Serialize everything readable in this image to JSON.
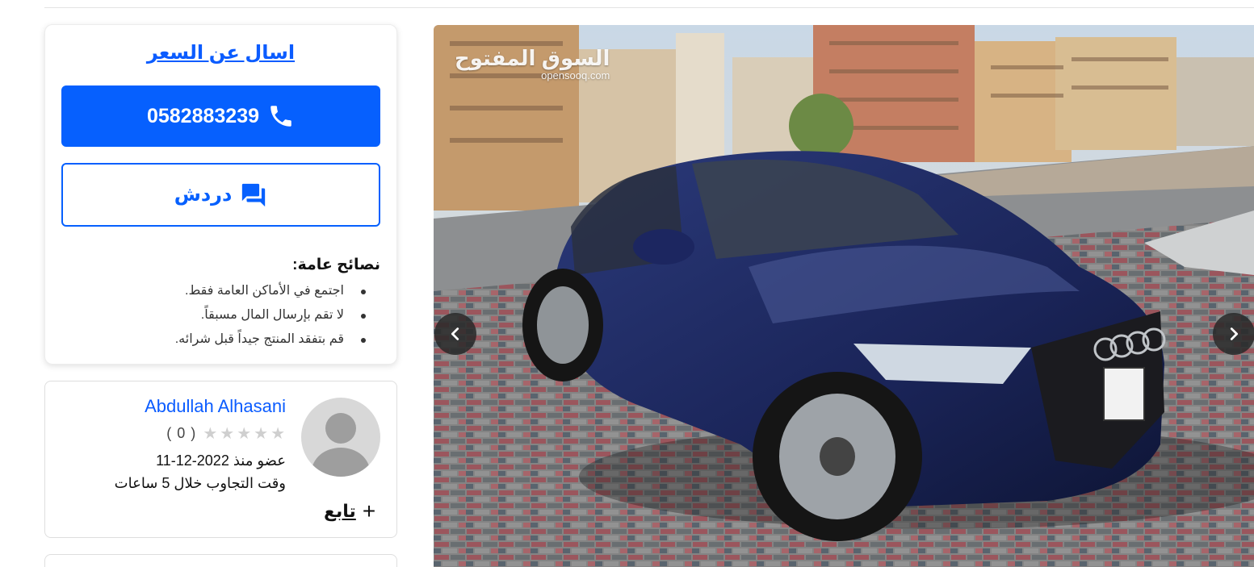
{
  "contact": {
    "ask_price": "اسال عن السعر",
    "phone": "0582883239",
    "chat": "دردش",
    "phone_icon": "phone-icon",
    "chat_icon": "chat-icon",
    "accent_color": "#0660fe"
  },
  "tips": {
    "title": "نصائح عامة:",
    "items": [
      "اجتمع في الأماكن العامة فقط.",
      "لا تقم بإرسال المال مسبقاً.",
      "قم بتفقد المنتج جيداً قبل شرائه."
    ]
  },
  "seller": {
    "name": "Abdullah Alhasani",
    "rating_count": "( 0 )",
    "stars_filled": 0,
    "stars_total": 5,
    "member_since": "عضو منذ 2022-12-11",
    "response_time": "وقت التجاوب خلال 5 ساعات",
    "follow_label": "تابع",
    "follow_icon": "plus-icon"
  },
  "gallery": {
    "watermark_ar": "السوق المفتوح",
    "watermark_en": "opensooq.com",
    "prev_icon": "chevron-left-icon",
    "next_icon": "chevron-right-icon"
  }
}
